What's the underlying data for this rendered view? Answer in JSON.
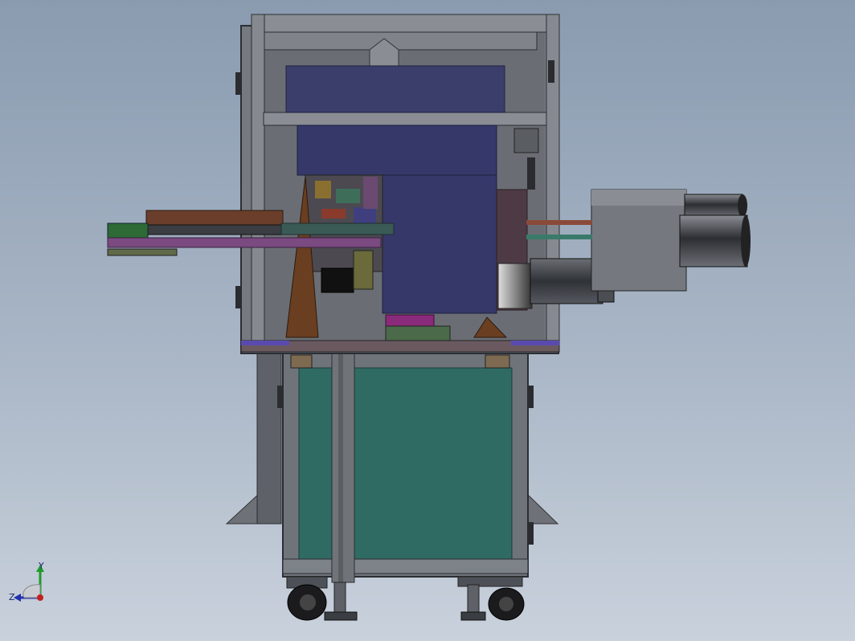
{
  "viewport": {
    "background_top": "#8a9bb0",
    "background_bottom": "#c9d1dc"
  },
  "model": {
    "frame_color": "#7d8188",
    "frame_dark": "#4d5157",
    "cabinet_color": "#2f6b63",
    "top_box_color": "#3b3d6a",
    "motor_color": "#3d4046"
  },
  "triad": {
    "x_color": "#c22020",
    "y_color": "#1f9a2a",
    "z_color": "#2030b0",
    "y_label": "Y",
    "z_label": "Z"
  }
}
